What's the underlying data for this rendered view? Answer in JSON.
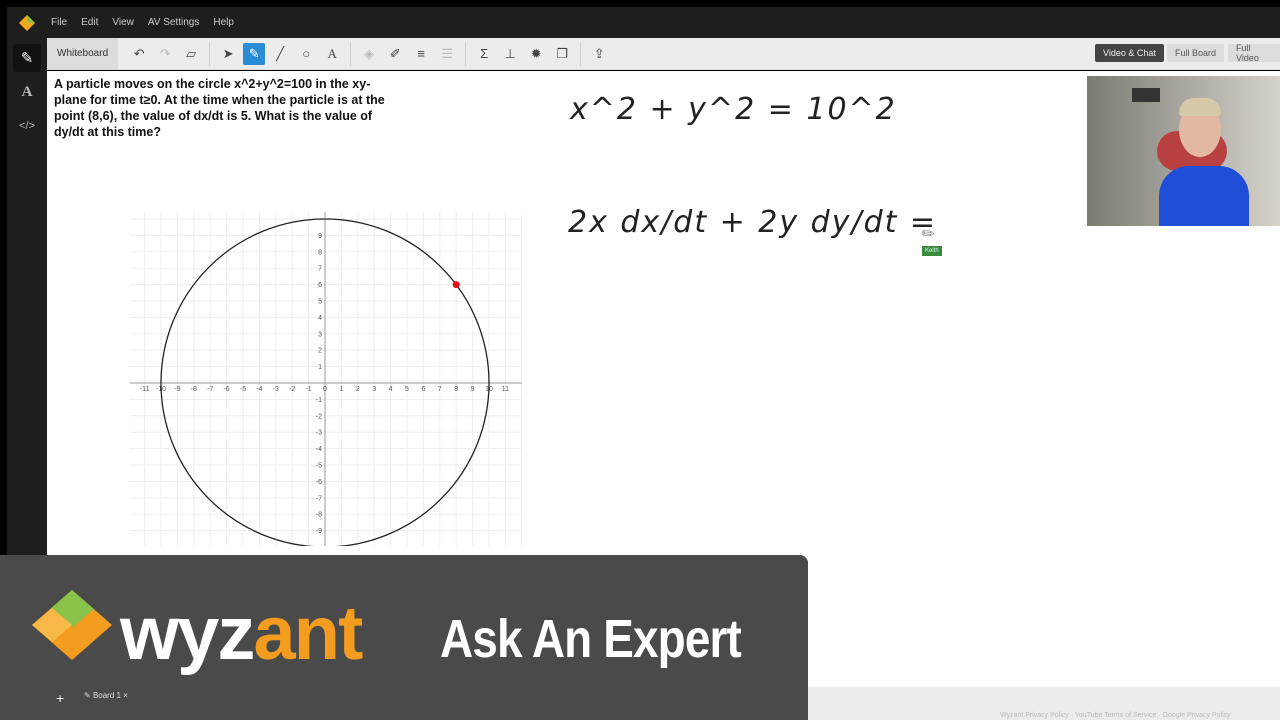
{
  "menu": [
    "File",
    "Edit",
    "View",
    "AV Settings",
    "Help"
  ],
  "toolbar": {
    "tab": "Whiteboard",
    "tools": [
      "undo",
      "redo",
      "eraser",
      "select",
      "pen",
      "line",
      "shape",
      "text",
      "fill",
      "highlighter",
      "line-weight",
      "dash",
      "sigma",
      "graph",
      "settings",
      "duplicate",
      "upload"
    ],
    "selected_tool": "pen",
    "accent": "#2a8bd6"
  },
  "view_buttons": [
    "Video & Chat",
    "Full Board",
    "Full Video"
  ],
  "active_view": "Video & Chat",
  "question": "A particle moves on the circle x^2+y^2=100 in the xy-plane for time t≥0. At the time when the particle is at the point (8,6), the value of dx/dt is 5. What is the value of dy/dt at this time?",
  "graph": {
    "x_ticks": [
      -11,
      -10,
      -9,
      -8,
      -7,
      -6,
      -5,
      -4,
      -3,
      -2,
      -1,
      0,
      1,
      2,
      3,
      4,
      5,
      6,
      7,
      8,
      9,
      10,
      11
    ],
    "y_ticks": [
      9,
      8,
      7,
      6,
      5,
      4,
      3,
      2,
      1,
      -1,
      -2,
      -3,
      -4,
      -5,
      -6,
      -7,
      -8,
      -9
    ],
    "circle_radius": 10,
    "point": [
      8,
      6
    ],
    "point_color": "#e01010"
  },
  "handwriting": {
    "line1": "x^2 + y^2 = 10^2",
    "line2": "2x dx/dt + 2y dy/dt ="
  },
  "cursor_label": "Keith",
  "banner": {
    "brand_a": "wyz",
    "brand_b": "ant",
    "tagline": "Ask An Expert"
  },
  "boards": {
    "add": "+",
    "tab": "Board 1",
    "close": "×"
  },
  "footer": "Wyzant Privacy Policy · YouTube Terms of Service · Google Privacy Policy"
}
